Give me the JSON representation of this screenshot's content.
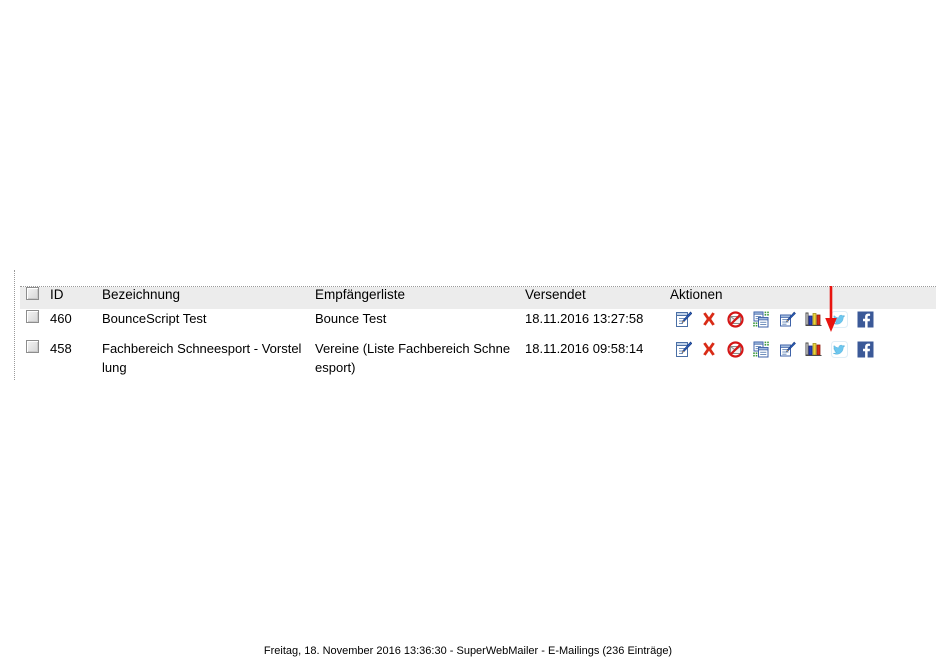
{
  "app": {
    "name": "SuperWebMailer",
    "section": "E-Mailings"
  },
  "table": {
    "columns": {
      "select": "",
      "id": "ID",
      "bezeichnung": "Bezeichnung",
      "empfaengerliste": "Empfängerliste",
      "versendet": "Versendet",
      "aktionen": "Aktionen"
    },
    "rows": [
      {
        "id": "460",
        "bezeichnung": "BounceScript Test",
        "empfaengerliste": "Bounce Test",
        "versendet": "18.11.2016 13:27:58",
        "actions": [
          {
            "name": "edit-mailing-icon",
            "title": "Bearbeiten"
          },
          {
            "name": "delete-mailing-icon",
            "title": "Löschen"
          },
          {
            "name": "stop-mailing-icon",
            "title": "Versand stoppen"
          },
          {
            "name": "copy-mailing-icon",
            "title": "Kopieren"
          },
          {
            "name": "properties-mailing-icon",
            "title": "Eigenschaften"
          },
          {
            "name": "statistics-icon",
            "title": "Statistik"
          },
          {
            "name": "twitter-share-icon",
            "title": "Twitter"
          },
          {
            "name": "facebook-share-icon",
            "title": "Facebook"
          }
        ]
      },
      {
        "id": "458",
        "bezeichnung": "Fachbereich Schneesport - Vorstellung",
        "empfaengerliste": "Vereine (Liste Fachbereich Schneesport)",
        "versendet": "18.11.2016 09:58:14",
        "actions": [
          {
            "name": "edit-mailing-icon",
            "title": "Bearbeiten"
          },
          {
            "name": "delete-mailing-icon",
            "title": "Löschen"
          },
          {
            "name": "stop-mailing-icon",
            "title": "Versand stoppen"
          },
          {
            "name": "copy-mailing-icon",
            "title": "Kopieren"
          },
          {
            "name": "properties-mailing-icon",
            "title": "Eigenschaften"
          },
          {
            "name": "statistics-icon",
            "title": "Statistik"
          },
          {
            "name": "twitter-share-icon",
            "title": "Twitter"
          },
          {
            "name": "facebook-share-icon",
            "title": "Facebook"
          }
        ]
      }
    ]
  },
  "annotation": {
    "type": "arrow-down",
    "color": "#e8140f",
    "points_to": "statistics-icon-row-460"
  },
  "footer": {
    "text": "Freitag, 18. November 2016 13:36:30 - SuperWebMailer - E-Mailings (236 Einträge)"
  },
  "colors": {
    "header_background": "#ececec",
    "page_background": "#ffffff",
    "grid_border": "#9a9a9a",
    "facebook_blue": "#3b5998",
    "twitter_blue": "#6cc7ef",
    "delete_red": "#d92b16",
    "annotation_red": "#e8140f"
  }
}
